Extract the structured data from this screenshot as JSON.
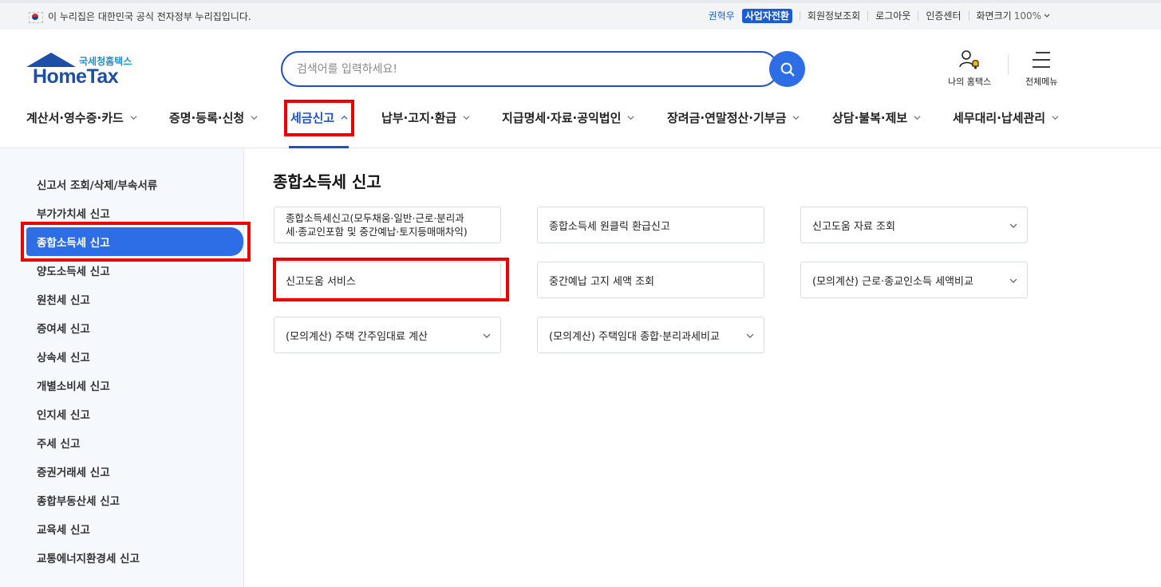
{
  "gov_banner": {
    "text": "이 누리집은 대한민국 공식 전자정부 누리집입니다.",
    "links": [
      "권혁우",
      "사업자전환",
      "회원정보조회",
      "로그아웃",
      "인증센터"
    ],
    "zoom_label": "화면크기",
    "zoom_value": "100%"
  },
  "logo": {
    "sub": "국세청홈택스",
    "main": "HomeTax"
  },
  "search": {
    "placeholder": "검색어를 입력하세요!"
  },
  "header_right": {
    "my_hometax": "나의 홈택스",
    "all_menu": "전체메뉴"
  },
  "gnb": {
    "items": [
      "계산서·영수증·카드",
      "증명·등록·신청",
      "세금신고",
      "납부·고지·환급",
      "지급명세·자료·공익법인",
      "장려금·연말정산·기부금",
      "상담·불복·제보",
      "세무대리·납세관리"
    ],
    "active_index": 2
  },
  "sidebar": {
    "items": [
      "신고서 조회/삭제/부속서류",
      "부가가치세 신고",
      "종합소득세 신고",
      "양도소득세 신고",
      "원천세 신고",
      "증여세 신고",
      "상속세 신고",
      "개별소비세 신고",
      "인지세 신고",
      "주세 신고",
      "증권거래세 신고",
      "종합부동산세 신고",
      "교육세 신고",
      "교통에너지환경세 신고"
    ],
    "active_index": 2
  },
  "content": {
    "title": "종합소득세 신고",
    "cards": [
      {
        "label": "종합소득세신고(모두채움·일반·근로·분리과세·종교인포함 및 중간예납·토지등매매차익)",
        "line1": "종합소득세신고(모두채움·일반·근로·분리과",
        "line2": "세·종교인포함 및 중간예납·토지등매매차익)"
      },
      {
        "label": "종합소득세 원클릭 환급신고"
      },
      {
        "label": "신고도움 자료 조회"
      },
      {
        "label": "신고도움 서비스"
      },
      {
        "label": "중간예납 고지 세액 조회"
      },
      {
        "label": "(모의계산) 근로·종교인소득 세액비교"
      },
      {
        "label": "(모의계산) 주택 간주임대료 계산"
      },
      {
        "label": "(모의계산) 주택임대 종합·분리과세비교"
      }
    ]
  },
  "colors": {
    "primary": "#1c50d0",
    "active_bg": "#2d6ee6",
    "highlight": "#ee0000",
    "sidebar_bg": "#f5f8fc"
  }
}
